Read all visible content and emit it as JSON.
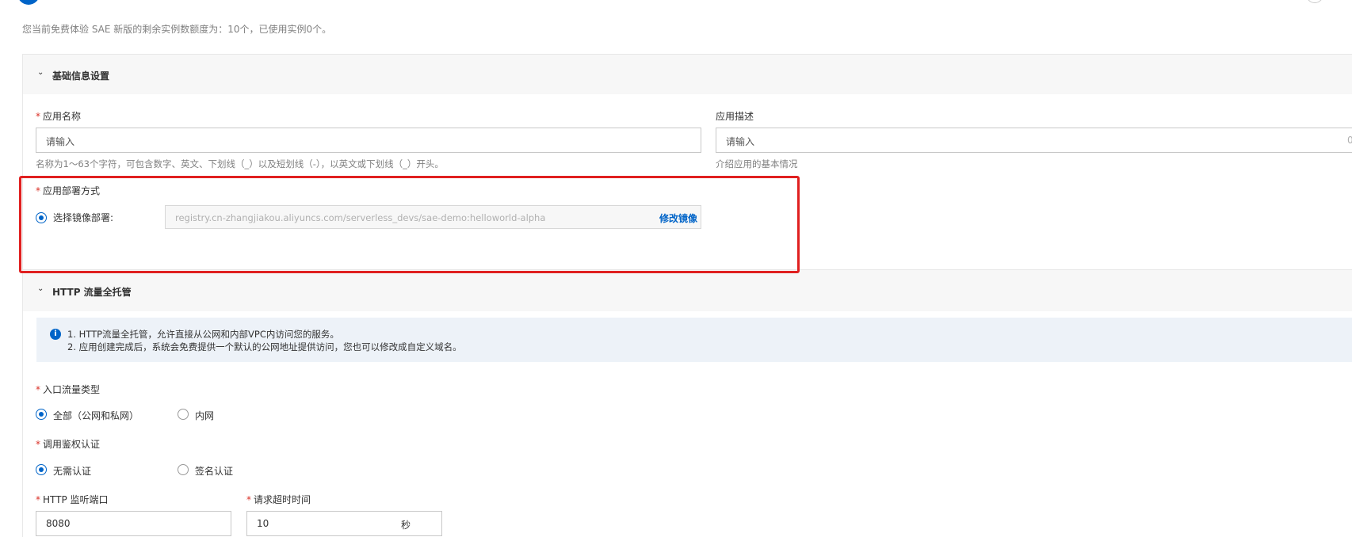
{
  "quota_text": "您当前免费体验 SAE 新版的剩余实例数额度为：10个，已使用实例0个。",
  "basic_section": {
    "title": "基础信息设置",
    "app_name": {
      "label": "应用名称",
      "placeholder": "请输入",
      "hint": "名称为1～63个字符，可包含数字、英文、下划线（_）以及短划线（-），以英文或下划线（_）开头。"
    },
    "app_desc": {
      "label": "应用描述",
      "placeholder": "请输入",
      "counter": "0",
      "hint": "介绍应用的基本情况"
    },
    "deploy": {
      "label": "应用部署方式",
      "option_label": "选择镜像部署:",
      "image_url": "registry.cn-zhangjiakou.aliyuncs.com/serverless_devs/sae-demo:helloworld-alpha",
      "edit_label": "修改镜像"
    }
  },
  "http_section": {
    "title": "HTTP 流量全托管",
    "info_line1": "1. HTTP流量全托管，允许直接从公网和内部VPC内访问您的服务。",
    "info_line2": "2. 应用创建完成后，系统会免费提供一个默认的公网地址提供访问，您也可以修改成自定义域名。",
    "ingress": {
      "label": "入口流量类型",
      "option_all": "全部（公网和私网）",
      "option_internal": "内网",
      "selected": "全部（公网和私网）"
    },
    "auth": {
      "label": "调用鉴权认证",
      "option_none": "无需认证",
      "option_sign": "签名认证",
      "selected": "无需认证"
    },
    "port": {
      "label": "HTTP 监听端口",
      "value": "8080"
    },
    "timeout": {
      "label": "请求超时时间",
      "value": "10",
      "unit": "秒"
    }
  },
  "colors": {
    "accent": "#0064c8",
    "required": "#d93026",
    "highlight_box": "#e02020",
    "info_bg": "#edf2f8"
  }
}
